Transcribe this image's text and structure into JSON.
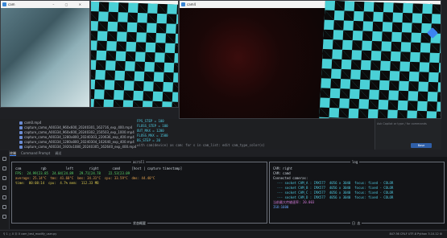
{
  "windows": [
    {
      "title": "cam",
      "type": "photo"
    },
    {
      "title": "cam",
      "type": "checker"
    },
    {
      "title": "cam4",
      "type": "dark"
    }
  ],
  "editor": {
    "files": [
      "cam0.mp4",
      "capture_camo_A00334_960x600_20240301_162716_exp_400.mp4",
      "capture_camo_A00334_960x600_20240302_150503_exp_1000.mp4",
      "capture_camo_A00334_1280x800_20240303_220636_exp_400.mp4",
      "capture_camo_A00334_1280x800_20240304_162640_exp_400.mp4",
      "capture_camo_A00334_1920x1080_20240305_162640_exp_400.mp4"
    ],
    "code": [
      {
        "n": "",
        "t": "FPS_STEP = 100"
      },
      {
        "n": "",
        "t": "FLOSS_STEP = 100"
      },
      {
        "n": "",
        "t": "OUT_MAX = 1200"
      },
      {
        "n": "",
        "t": "FLOSS_MAX = 1500"
      },
      {
        "n": "",
        "t": "BS_STEP = 20"
      },
      {
        "n": "",
        "t": "with cam(device) as cam:    for s in cam_list:    edit cam_type_color(s)"
      }
    ]
  },
  "ai": {
    "placeholder": "Ask Copilot or type / for commands",
    "button": "Base"
  },
  "tabs": [
    "终端",
    "Command Prompt",
    "调试"
  ],
  "terminal": {
    "left_title": "acroll",
    "left_footer": "状态概要",
    "right_title": "log",
    "right_footer": "日 志",
    "header": "cam          rgb          left        right       camd      [host | capture timestamp]",
    "fps": "FPS:  24.99[23.85  24.84[24.89   29.71[24.78    22.53[23.09",
    "avg": "average: 25.14°C  tms: 41.60°C  bms: 34.31°C  cpu: 33.59°C  dms: 44.40°C",
    "time": "time:  00:08:14  cpu:  4.7% mem:  112.33 MB",
    "log_lines": [
      "CAM: right",
      "CAM: camd",
      "Connected cameras:",
      "  --- socket CAM_A : IMX577  4056 x 3040  focus: fixed - COLOR",
      "  --- socket CAM_B : IMX577  4056 x 3040  focus: fixed - COLOR",
      "  --- socket CAM_C : IMX577  4056 x 3040  focus: fixed - COLOR",
      "  --- socket CAM_D : IMX577  4056 x 3040  focus: fixed - COLOR",
      "当前最大传输速率: 20.003",
      "ISO:1600"
    ]
  },
  "status": {
    "left": "⚲ 1 △ 0  Ⓐ 0   cam_test_modify_user.py",
    "right": "847:36   CRLF   UTF-8   Python  3.10.12  ⚙"
  }
}
